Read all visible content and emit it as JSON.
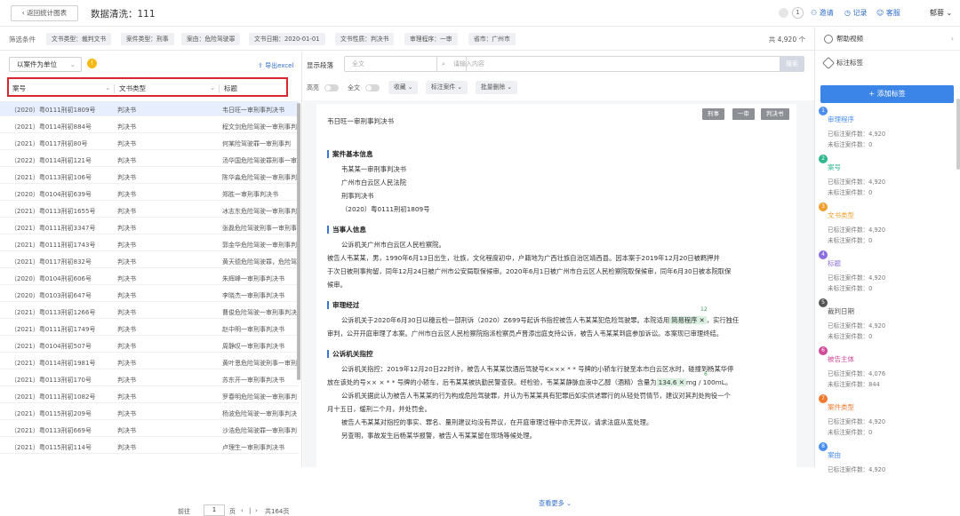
{
  "topbar": {
    "back_label": "返回统计图表",
    "title": "数据清洗：111",
    "badge": "1",
    "invite": "邀请",
    "record": "记录",
    "service": "客服",
    "user": "郁蓉"
  },
  "filters": {
    "label": "筛选条件",
    "chips": [
      "文书类型：裁判文书",
      "案件类型：刑事",
      "案由：危险驾驶罪",
      "文书日期：2020-01-01",
      "文书性质：判决书",
      "审理程序：一审",
      "省市：广州市"
    ],
    "total": "共 4,920 个"
  },
  "left": {
    "unit_select": "以案件为单位",
    "export": "导出excel",
    "columns": [
      "案号",
      "文书类型",
      "标题"
    ],
    "rows": [
      {
        "case": "（2020）粤0111刑初1809号",
        "type": "判决书",
        "title": "韦日旺一审刑事判决书"
      },
      {
        "case": "（2021）粤0114刑初884号",
        "type": "判决书",
        "title": "程文剑危险驾驶一审刑事判"
      },
      {
        "case": "（2021）粤0117刑初80号",
        "type": "判决书",
        "title": "何某险驾驶罪一审刑事判"
      },
      {
        "case": "（2022）粤0114刑初121号",
        "type": "判决书",
        "title": "汤华国危险驾驶罪刑事一审"
      },
      {
        "case": "（2021）粤0113刑初106号",
        "type": "判决书",
        "title": "陈华淼危险驾驶一审刑事判"
      },
      {
        "case": "（2020）粤0104刑初639号",
        "type": "判决书",
        "title": "郑胜一审刑事判决书"
      },
      {
        "case": "（2021）粤0113刑初1655号",
        "type": "判决书",
        "title": "冰志东危险驾驶一审刑事判"
      },
      {
        "case": "（2021）粤0111刑初3347号",
        "type": "判决书",
        "title": "张磊危险驾驶刑事一审刑事"
      },
      {
        "case": "（2021）粤0111刑初1743号",
        "type": "判决书",
        "title": "郭金华危险驾驶一审刑事判"
      },
      {
        "case": "（2021）粤0117刑初832号",
        "type": "判决书",
        "title": "黄天德危险驾驶罪，危险驾"
      },
      {
        "case": "（2020）粤0104刑初606号",
        "type": "判决书",
        "title": "朱辉峰一审刑事判决书"
      },
      {
        "case": "（2020）粤0103刑初647号",
        "type": "判决书",
        "title": "李晓杰一审刑事判决书"
      },
      {
        "case": "（2021）粤0113刑初1266号",
        "type": "判决书",
        "title": "曹俊危险驾驶一审刑事判决"
      },
      {
        "case": "（2021）粤0111刑初1749号",
        "type": "判决书",
        "title": "赵中明一审刑事判决书"
      },
      {
        "case": "（2021）粤0104刑初507号",
        "type": "判决书",
        "title": "周静叹一审刑事判决书"
      },
      {
        "case": "（2021）粤0114刑初1981号",
        "type": "判决书",
        "title": "黄叶恩危险驾驶刑事一审刑"
      },
      {
        "case": "（2021）粤0113刑初170号",
        "type": "判决书",
        "title": "苏东开一审刑事判决书"
      },
      {
        "case": "（2021）粤0111刑初1082号",
        "type": "判决书",
        "title": "罗春明危险驾驶一审刑事判"
      },
      {
        "case": "（2021）粤0115刑初209号",
        "type": "判决书",
        "title": "杨波危险驾驶一审刑事判决"
      },
      {
        "case": "（2021）粤0113刑初669号",
        "type": "判决书",
        "title": "沙浩危险驾驶罪一审刑事判"
      },
      {
        "case": "（2021）粤0115刑初114号",
        "type": "判决书",
        "title": "卢理生一审刑事判决书"
      }
    ],
    "pager_prev": "前往",
    "pager_page": "1",
    "pager_unit": "页",
    "pager_total": "共164页"
  },
  "mid": {
    "field_label": "显示段落",
    "field_select": "全文",
    "search_placeholder": "请输入内容",
    "search_btn": "搜索",
    "toggle1": "高亮",
    "toggle2": "全文",
    "btn_collect": "收藏",
    "btn_tag": "标注案件",
    "btn_batch": "批量删除",
    "doc_title": "韦日旺一审刑事判决书",
    "doc_tags": [
      "刑事",
      "一审",
      "判决书"
    ],
    "sections": {
      "basic": "案件基本信息",
      "party": "当事人信息",
      "process": "审理经过",
      "accuse": "公诉机关指控"
    },
    "basic_lines": [
      "韦某某一审刑事判决书",
      "广州市白云区人民法院",
      "刑事判决书",
      "（2020）粤0111刑初1809号"
    ],
    "party_lines": [
      "公诉机关广州市白云区人民检察院。",
      "被告人韦某某，男，1990年6月13日出生，壮族，文化程度初中，户籍地为广西壮族自治区靖西县。因本案于2019年12月20日被羁押并",
      "于次日被刑事拘留，同年12月24日被广州市公安局取保候审。2020年6月1日被广州市白云区人民检察院取保候审，同年6月30日被本院取保",
      "候审。"
    ],
    "process_line1": "公诉机关于2020年6月30日以穗云检一部刑诉（2020）Z699号起诉书指控被告人韦某某犯危险驾驶罪。本院适用",
    "process_hl": "简易程序",
    "process_line1_end": "，实行独任",
    "process_line2": "审判，公开开庭审理了本案。广州市白云区人民检察院指派检察员卢晋添出庭支持公诉，被告人韦某某到庭参加诉讼。本案现已审理终结。",
    "hl_num1": "12",
    "accuse_lines": [
      "公诉机关指控：2019年12月20日22时许，被告人韦某某饮酒后驾驶号K××× * * 号牌的小轿车行驶至本市白云区水时，碰撞到杨某华停",
      "放在该处的号×× × * * 号牌的小轿车，后韦某某被执勤民警查获。经检验，韦某某静脉血液中乙醇（酒精）含量为",
      "公诉机关据此认为被告人韦某某的行为构成危险驾驶罪，并认为韦某某具有犯罪后如实供述罪行的从轻处罚情节，建议对其判处拘役一个",
      "月十五日，缓刑二个月，并处罚金。",
      "被告人韦某某对指控的事实、罪名、量刑建议均没有异议，在开庭审理过程中亦无异议，请求法庭从宽处理。",
      "另查明，事故发生后杨某华报警，被告人韦某某留在现场等候处理。"
    ],
    "accuse_hl": "134.6",
    "accuse_unit": "mg / 100mL。",
    "hl_num2": "6",
    "more": "查看更多"
  },
  "right": {
    "help_video": "帮助视频",
    "tag_label": "标注标签",
    "add_tag": "+ 添加标签",
    "tags": [
      {
        "num": "1",
        "name": "审理程序",
        "color": "#4a8ff0",
        "a": "已标注案件数：4,920",
        "b": "未标注案件数：0"
      },
      {
        "num": "2",
        "name": "案号",
        "color": "#2fb88e",
        "a": "已标注案件数：4,920",
        "b": "未标注案件数：0"
      },
      {
        "num": "3",
        "name": "文书类型",
        "color": "#f0a030",
        "a": "已标注案件数：4,920",
        "b": "未标注案件数：0"
      },
      {
        "num": "4",
        "name": "标题",
        "color": "#8b6fe0",
        "a": "已标注案件数：4,920",
        "b": "未标注案件数：0"
      },
      {
        "num": "5",
        "name": "裁判日期",
        "color": "#555555",
        "a": "已标注案件数：4,920",
        "b": "未标注案件数：0"
      },
      {
        "num": "6",
        "name": "被告主体",
        "color": "#d14a9a",
        "a": "已标注案件数：4,076",
        "b": "未标注案件数：844"
      },
      {
        "num": "7",
        "name": "案件类型",
        "color": "#f07a30",
        "a": "已标注案件数：4,920",
        "b": "未标注案件数：0"
      },
      {
        "num": "8",
        "name": "案由",
        "color": "#4a8ff0",
        "a": "已标注案件数：4,920",
        "b": ""
      }
    ]
  }
}
